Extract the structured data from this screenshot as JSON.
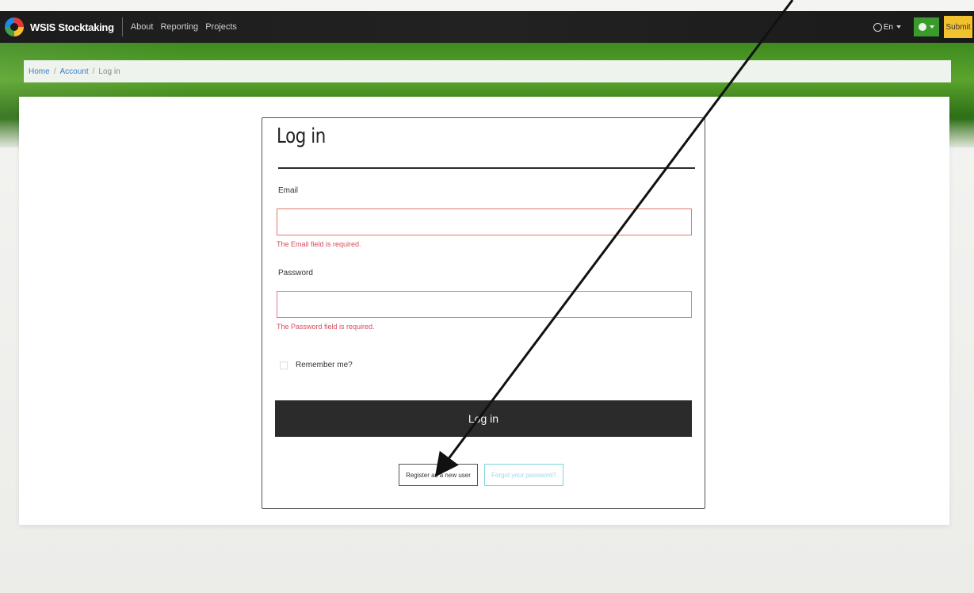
{
  "navbar": {
    "brand": "WSIS Stocktaking",
    "links": [
      "About",
      "Reporting",
      "Projects"
    ],
    "language": "En",
    "submit_label": "Submit"
  },
  "breadcrumb": {
    "home": "Home",
    "account": "Account",
    "current": "Log in"
  },
  "login": {
    "title": "Log in",
    "email_label": "Email",
    "email_value": "",
    "email_error": "The Email field is required.",
    "password_label": "Password",
    "password_value": "",
    "password_error": "The Password field is required.",
    "remember_label": "Remember me?",
    "submit_label": "Log in",
    "register_label": "Register as a new user",
    "forgot_label": "Forgot your password?"
  },
  "colors": {
    "nav_bg": "#1c1c1c",
    "banner_green": "#4f9a26",
    "submit_yellow": "#f2c12e",
    "user_green": "#3a9b2d",
    "error_red": "#d94a5a",
    "login_button": "#2b2b2b",
    "forgot_border": "#7fd3e0"
  },
  "icons": {
    "logo": "wsis-logo-icon",
    "language": "globe-icon",
    "user": "user-icon"
  }
}
